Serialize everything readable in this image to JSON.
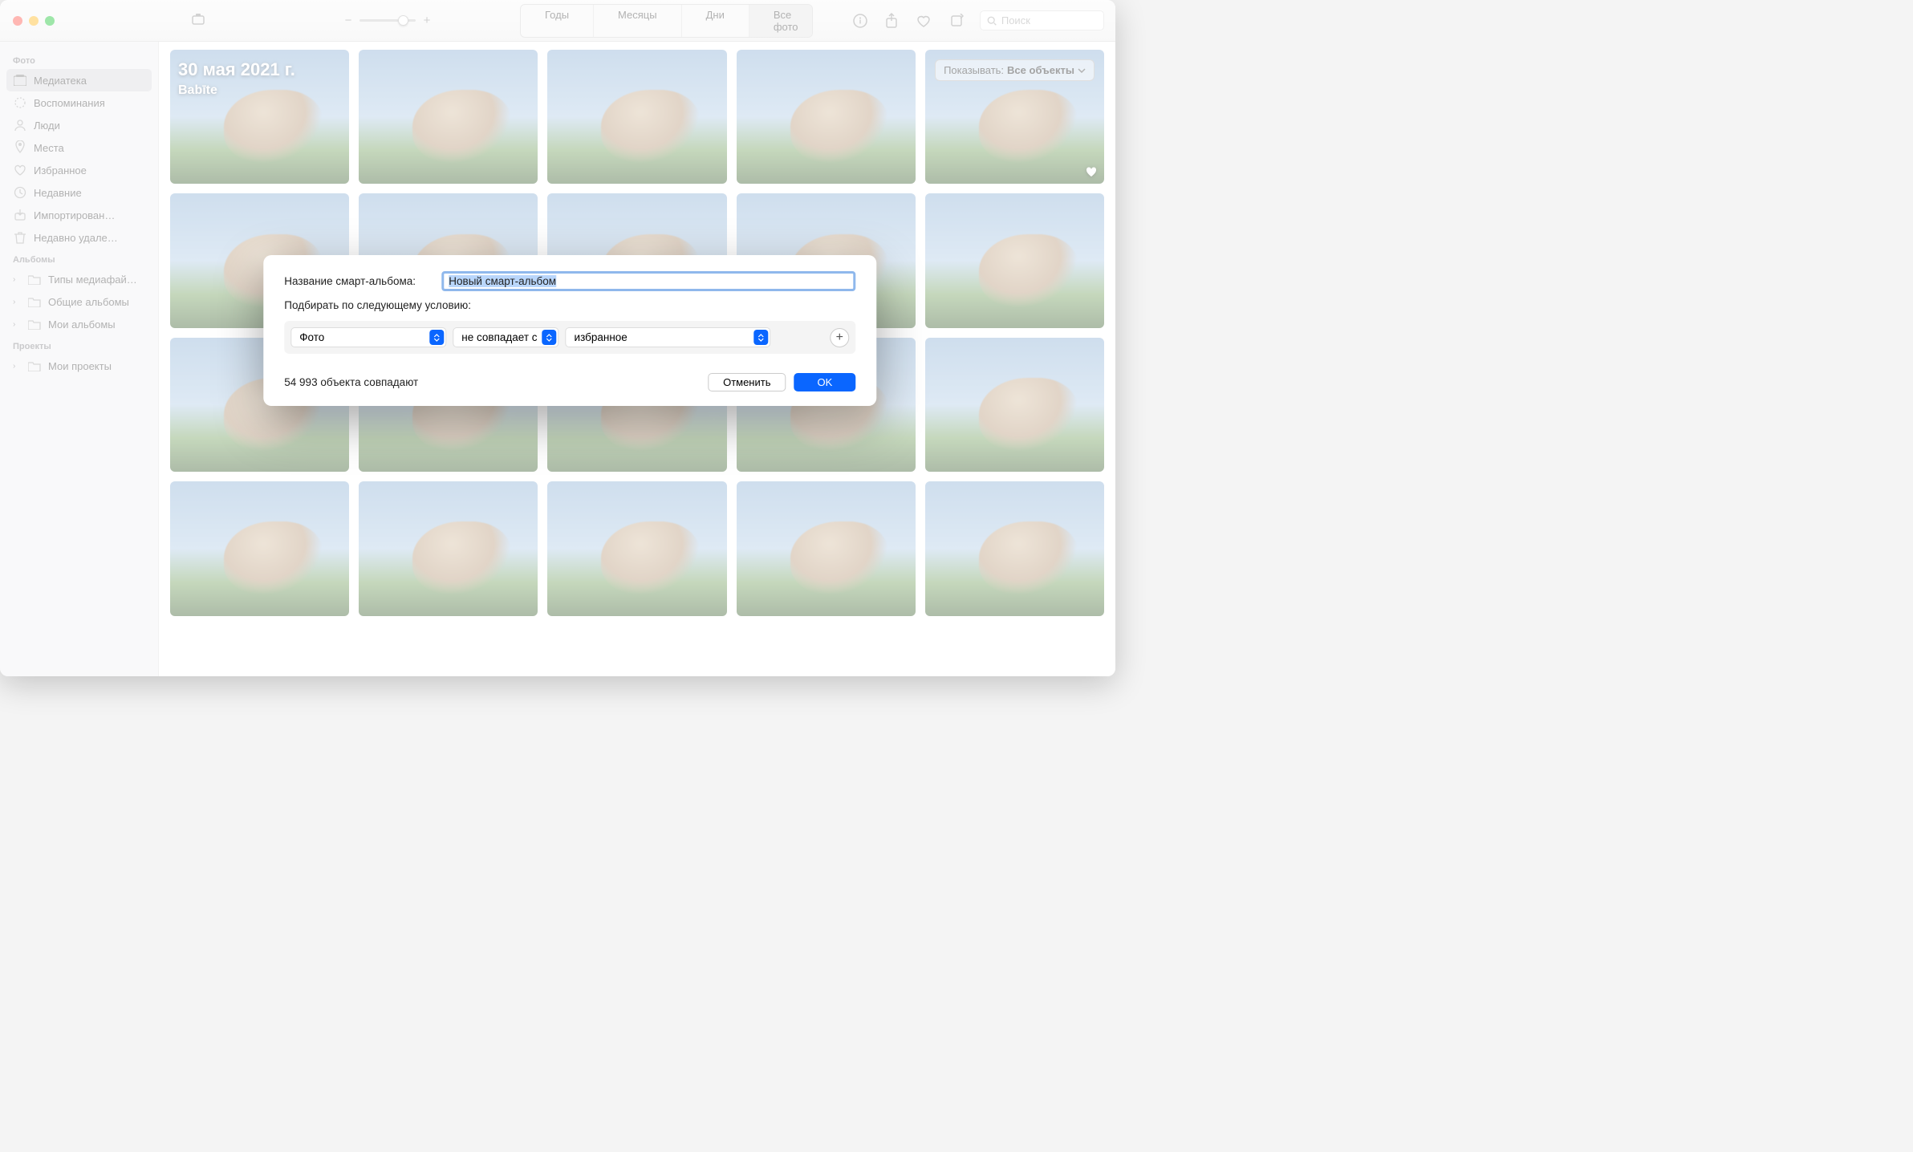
{
  "toolbar": {
    "segments": [
      "Годы",
      "Месяцы",
      "Дни",
      "Все фото"
    ],
    "active_segment": 3,
    "search_placeholder": "Поиск"
  },
  "sidebar": {
    "sections": [
      {
        "header": "Фото",
        "items": [
          {
            "icon": "library",
            "label": "Медиатека",
            "selected": true
          },
          {
            "icon": "memories",
            "label": "Воспоминания"
          },
          {
            "icon": "people",
            "label": "Люди"
          },
          {
            "icon": "places",
            "label": "Места"
          },
          {
            "icon": "heart",
            "label": "Избранное"
          },
          {
            "icon": "clock",
            "label": "Недавние"
          },
          {
            "icon": "import",
            "label": "Импортирован…"
          },
          {
            "icon": "trash",
            "label": "Недавно удале…"
          }
        ]
      },
      {
        "header": "Альбомы",
        "items": [
          {
            "icon": "folder",
            "label": "Типы медиафай…",
            "chevron": true
          },
          {
            "icon": "folder",
            "label": "Общие альбомы",
            "chevron": true
          },
          {
            "icon": "folder",
            "label": "Мои альбомы",
            "chevron": true
          }
        ]
      },
      {
        "header": "Проекты",
        "items": [
          {
            "icon": "folder",
            "label": "Мои проекты",
            "chevron": true
          }
        ]
      }
    ]
  },
  "content": {
    "date_heading": "30 мая 2021 г.",
    "location": "Babīte",
    "show_label": "Показывать:",
    "show_value": "Все объекты",
    "thumb_count": 20,
    "favorites_at": [
      4
    ]
  },
  "dialog": {
    "name_label": "Название смарт-альбома:",
    "name_value": "Новый смарт-альбом",
    "condition_label": "Подбирать по следующему условию:",
    "select1": "Фото",
    "select2": "не совпадает с",
    "select3": "избранное",
    "match_count": "54 993 объекта совпадают",
    "cancel": "Отменить",
    "ok": "OK"
  }
}
